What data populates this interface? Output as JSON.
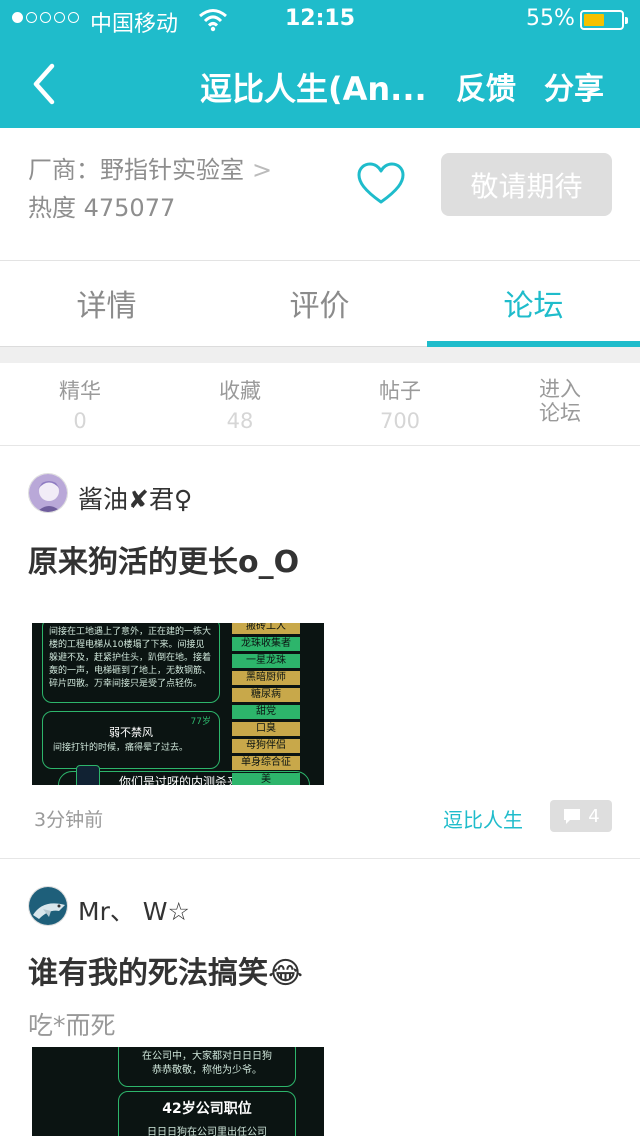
{
  "status_bar": {
    "carrier": "中国移动",
    "time": "12:15",
    "battery_percent": "55%",
    "battery_level": 0.55,
    "signal_dots_filled": 1,
    "signal_dots_total": 5
  },
  "nav": {
    "back_icon": "chevron-left-icon",
    "title": "逗比人生(An...",
    "feedback": "反馈",
    "share": "分享"
  },
  "app_info": {
    "vendor_label": "厂商：野指针实验室",
    "vendor_chevron": ">",
    "heat_label": "热度 475077",
    "favorite_icon": "heart-outline-icon",
    "action_button": "敬请期待"
  },
  "tabs": [
    {
      "label": "详情"
    },
    {
      "label": "评价"
    },
    {
      "label": "论坛"
    }
  ],
  "active_tab": "论坛",
  "forum_stats": {
    "items": [
      {
        "label": "精华",
        "value": "0"
      },
      {
        "label": "收藏",
        "value": "48"
      },
      {
        "label": "帖子",
        "value": "700"
      }
    ],
    "enter_line1": "进入",
    "enter_line2": "论坛"
  },
  "posts": [
    {
      "author": "酱油✘君♀",
      "title": "原来狗活的更长o_O",
      "time": "3分钟前",
      "game": "逗比人生",
      "comments": "4",
      "thumbnail": {
        "story_text": "间接在工地遇上了意外，正在建的一栋大楼的工程电梯从10楼塌了下来。间接见躲避不及，赶紧护住头，趴倒在地。接着轰的一声，电梯砸到了地上，无数钢筋、碎片四散。万幸间接只是受了点轻伤。",
        "card_title": "弱不禁风",
        "card_age": "77岁",
        "card_text": "间接打针的时候，痛得晕了过去。",
        "bottom_text": "你们是过呀的内测杀来子",
        "tags": [
          "搬砖工人",
          "龙珠收集者",
          "一星龙珠",
          "黑暗厨师",
          "糖尿病",
          "甜党",
          "口臭",
          "母狗伴侣",
          "单身综合征",
          "美"
        ]
      }
    },
    {
      "author": "Mr、 W☆",
      "title": "谁有我的死法搞笑",
      "title_emoji": "😂",
      "subtitle": "吃*而死",
      "thumbnail": {
        "top_text_1": "在公司中，大家都对日日日狗",
        "top_text_2": "恭恭敬敬，称他为少爷。",
        "card_title": "42岁公司职位",
        "card_text": "日日日狗在公司里出任公司"
      }
    }
  ],
  "colors": {
    "accent": "#1fbccb",
    "battery": "#f6c100",
    "game_green": "#2db56b"
  }
}
